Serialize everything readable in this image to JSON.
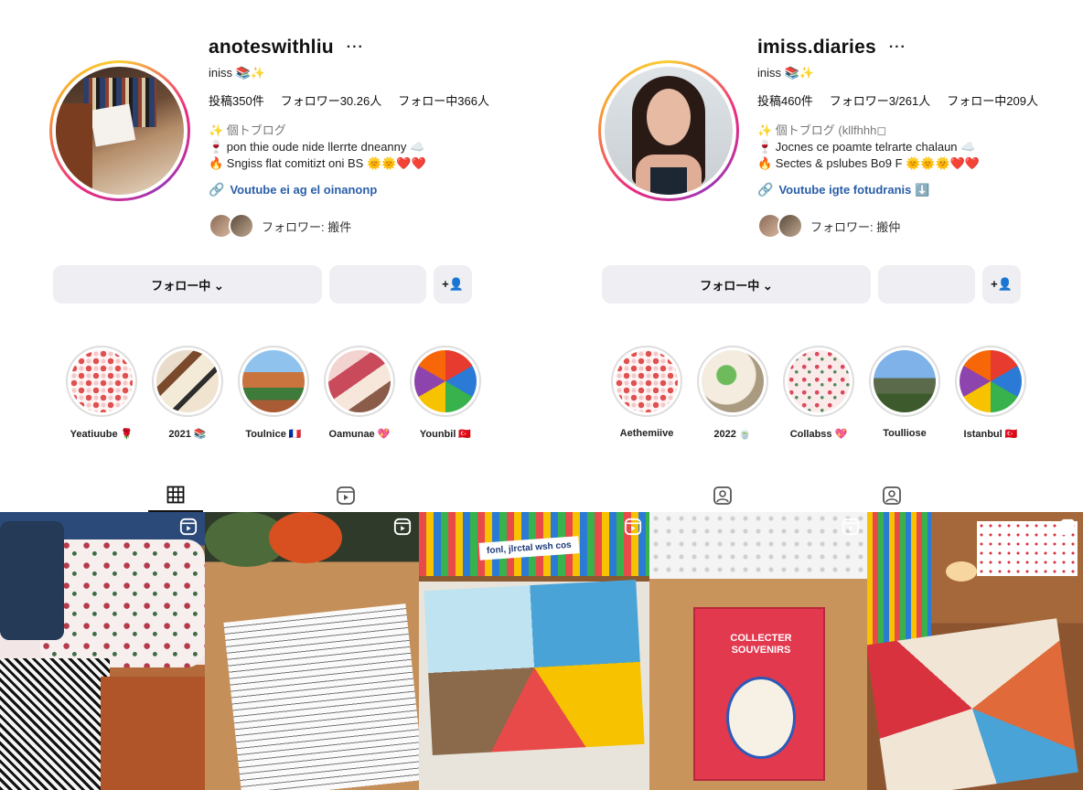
{
  "profiles": [
    {
      "username": "anoteswithliu",
      "more": "···",
      "subname": "iniss 📚✨",
      "stats": {
        "posts": "投稿350件",
        "followers": "フォロワー30.26人",
        "following": "フォロー中366人"
      },
      "bio": {
        "category": "✨ 個トブログ",
        "line1": "🍷 pon thie oude nide llerrte dneanny ☁️",
        "line2": "🔥 Sngiss flat comitizt oni BS 🌞🌞❤️❤️"
      },
      "link": "Voutube ei ag el oinanonp",
      "followers_line": "フォロワー: 搬件",
      "buttons": {
        "follow": "フォロー中 ⌄",
        "message": "",
        "add": "+👤"
      },
      "highlights": [
        {
          "label": "Yeatiuube 🌹"
        },
        {
          "label": "2021 📚"
        },
        {
          "label": "Toulnice 🇫🇷"
        },
        {
          "label": "Oamunae 💖"
        },
        {
          "label": "Younbil 🇹🇷"
        }
      ]
    },
    {
      "username": "imiss.diaries",
      "more": "···",
      "subname": "iniss 📚✨",
      "stats": {
        "posts": "投稿460件",
        "followers": "フォロワー3/261人",
        "following": "フォロー中209人"
      },
      "bio": {
        "category": "✨ 個トブログ (kllfhhh◻",
        "line1": "🍷 Jocnes ce poamte telrarte chalaun ☁️",
        "line2": "🔥 Sectes & pslubes Bo9 F 🌞🌞🌞❤️❤️"
      },
      "link": "Voutube igte fotudranis ⬇️",
      "followers_line": "フォロワー: 搬仲",
      "buttons": {
        "follow": "フォロー中 ⌄",
        "message": "",
        "add": "+👤"
      },
      "highlights": [
        {
          "label": "Aethemiive"
        },
        {
          "label": "2022 🍵"
        },
        {
          "label": "Collabss 💖"
        },
        {
          "label": "Toulliose"
        },
        {
          "label": "Istanbul 🇹🇷"
        }
      ]
    }
  ],
  "grid_posts": [
    {
      "name": "post-floral-pouch"
    },
    {
      "name": "post-sketchbook"
    },
    {
      "name": "post-journal-spread",
      "caption": "fonl, jlrctal wsh cos"
    },
    {
      "name": "post-red-book",
      "caption": "COLLECTER SOUVENIRS"
    },
    {
      "name": "post-craft-desk"
    }
  ],
  "colors": {
    "accent_link": "#2a5ea8",
    "button_bg": "#efeff3",
    "ring_start": "#f9ce34",
    "ring_mid": "#ee2a7b"
  }
}
